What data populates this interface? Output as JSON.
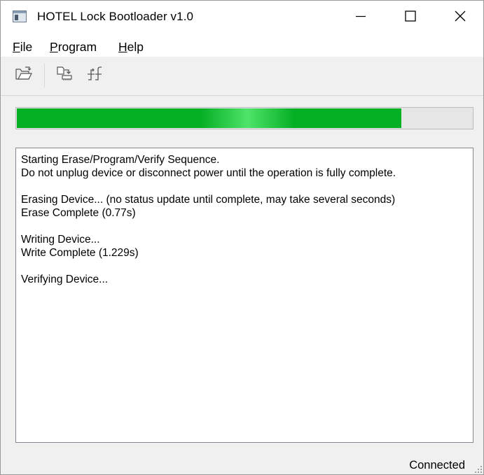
{
  "window": {
    "title": "HOTEL Lock Bootloader v1.0",
    "controls": {
      "minimize": "minimize-icon",
      "maximize": "maximize-icon",
      "close": "close-icon"
    }
  },
  "menu": {
    "items": [
      {
        "accel": "F",
        "rest": "ile"
      },
      {
        "accel": "P",
        "rest": "rogram"
      },
      {
        "accel": "H",
        "rest": "elp"
      }
    ]
  },
  "toolbar": {
    "buttons": [
      "open-folder-icon",
      "program-device-icon",
      "reset-icon"
    ]
  },
  "progress": {
    "fraction": 0.845,
    "color": "#06b025"
  },
  "log": {
    "lines": [
      "Starting Erase/Program/Verify Sequence.",
      "Do not unplug device or disconnect power until the operation is fully complete.",
      "",
      "Erasing Device... (no status update until complete, may take several seconds)",
      "Erase Complete (0.77s)",
      "",
      "Writing Device...",
      "Write Complete (1.229s)",
      "",
      "Verifying Device..."
    ]
  },
  "status": {
    "text": "Connected"
  }
}
